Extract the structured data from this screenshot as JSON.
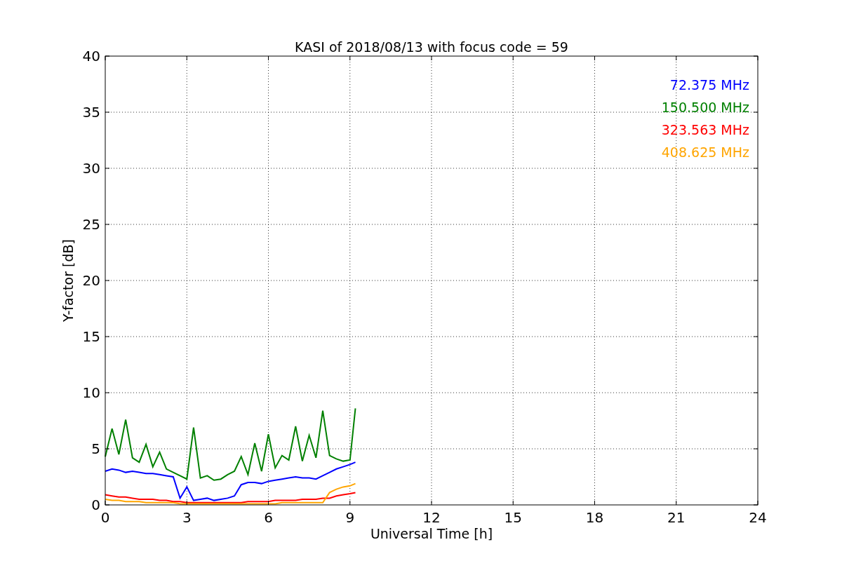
{
  "figure": {
    "chart_data": {
      "type": "line",
      "title": "KASI of 2018/08/13 with focus code = 59",
      "xlabel": "Universal Time [h]",
      "ylabel": "Y-factor [dB]",
      "x": [
        0,
        0.25,
        0.5,
        0.75,
        1,
        1.25,
        1.5,
        1.75,
        2,
        2.25,
        2.5,
        2.75,
        3,
        3.25,
        3.5,
        3.75,
        4,
        4.25,
        4.5,
        4.75,
        5,
        5.25,
        5.5,
        5.75,
        6,
        6.25,
        6.5,
        6.75,
        7,
        7.25,
        7.5,
        7.75,
        8,
        8.25,
        8.5,
        8.75,
        9,
        9.2
      ],
      "series": [
        {
          "name": "72.375 MHz",
          "color": "#0000ff",
          "values": [
            3.0,
            3.2,
            3.1,
            2.9,
            3.0,
            2.9,
            2.8,
            2.8,
            2.7,
            2.6,
            2.5,
            0.6,
            1.6,
            0.4,
            0.5,
            0.6,
            0.4,
            0.5,
            0.6,
            0.8,
            1.8,
            2.0,
            2.0,
            1.9,
            2.1,
            2.2,
            2.3,
            2.4,
            2.5,
            2.4,
            2.4,
            2.3,
            2.6,
            2.9,
            3.2,
            3.4,
            3.6,
            3.8
          ]
        },
        {
          "name": "150.500 MHz",
          "color": "#008000",
          "values": [
            4.3,
            6.8,
            4.5,
            7.6,
            4.2,
            3.8,
            5.4,
            3.4,
            4.7,
            3.2,
            2.9,
            2.6,
            2.3,
            6.9,
            2.4,
            2.6,
            2.2,
            2.3,
            2.7,
            3.0,
            4.3,
            2.7,
            5.5,
            3.0,
            6.3,
            3.3,
            4.4,
            4.0,
            7.0,
            3.9,
            6.2,
            4.2,
            8.4,
            4.4,
            4.1,
            3.9,
            4.0,
            8.6
          ]
        },
        {
          "name": "323.563 MHz",
          "color": "#ff0000",
          "values": [
            0.9,
            0.8,
            0.7,
            0.7,
            0.6,
            0.5,
            0.5,
            0.5,
            0.4,
            0.4,
            0.3,
            0.3,
            0.2,
            0.2,
            0.2,
            0.2,
            0.2,
            0.2,
            0.2,
            0.2,
            0.2,
            0.3,
            0.3,
            0.3,
            0.3,
            0.4,
            0.4,
            0.4,
            0.4,
            0.5,
            0.5,
            0.5,
            0.6,
            0.6,
            0.8,
            0.9,
            1.0,
            1.1
          ]
        },
        {
          "name": "408.625 MHz",
          "color": "#ffa500",
          "values": [
            0.5,
            0.4,
            0.4,
            0.3,
            0.3,
            0.3,
            0.2,
            0.2,
            0.2,
            0.2,
            0.2,
            0.1,
            0.1,
            0.1,
            0.1,
            0.1,
            0.1,
            0.1,
            0.1,
            0.1,
            0.1,
            0.1,
            0.1,
            0.1,
            0.1,
            0.1,
            0.2,
            0.2,
            0.2,
            0.2,
            0.2,
            0.2,
            0.2,
            1.1,
            1.4,
            1.6,
            1.7,
            1.9
          ]
        }
      ],
      "grid": true,
      "xlim": [
        0,
        24
      ],
      "ylim": [
        0,
        40
      ],
      "xticks": [
        0,
        3,
        6,
        9,
        12,
        15,
        18,
        21,
        24
      ],
      "yticks": [
        0,
        5,
        10,
        15,
        20,
        25,
        30,
        35,
        40
      ]
    }
  }
}
